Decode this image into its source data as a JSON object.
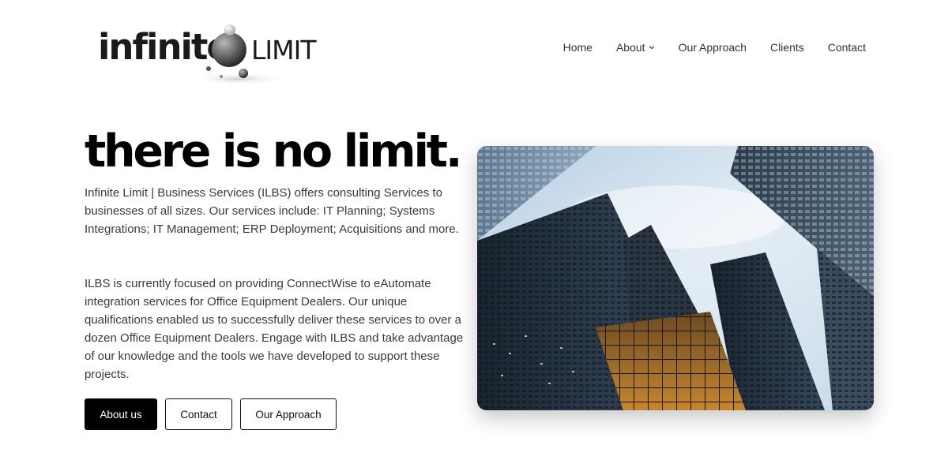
{
  "header": {
    "logo": {
      "word": "infinite",
      "word2": "LIMIT"
    },
    "nav": [
      {
        "label": "Home",
        "icon": null
      },
      {
        "label": "About",
        "icon": "chevron-down-icon"
      },
      {
        "label": "Our Approach",
        "icon": null
      },
      {
        "label": "Clients",
        "icon": null
      },
      {
        "label": "Contact",
        "icon": null
      }
    ]
  },
  "hero": {
    "title": "there is no limit.",
    "paragraph1": "Infinite Limit | Business Services (ILBS) offers consulting Services to businesses of all sizes. Our services include: IT Planning; Systems Integrations; IT Management; ERP Deployment; Acquisitions and more.",
    "paragraph2": "ILBS is currently focused on providing ConnectWise to eAutomate integration services for Office Equipment Dealers. Our unique qualifications enabled us to successfully deliver these services to over a dozen Office Equipment Dealers. Engage with ILBS and take advantage of our knowledge and the tools we have developed to support these projects.",
    "buttons": {
      "about": "About us",
      "contact": "Contact",
      "approach": "Our Approach"
    }
  },
  "colors": {
    "primary_button": "#000000",
    "text": "#3a3a3a",
    "sky": "#d4e2ee",
    "building_dark": "#1b2530"
  }
}
